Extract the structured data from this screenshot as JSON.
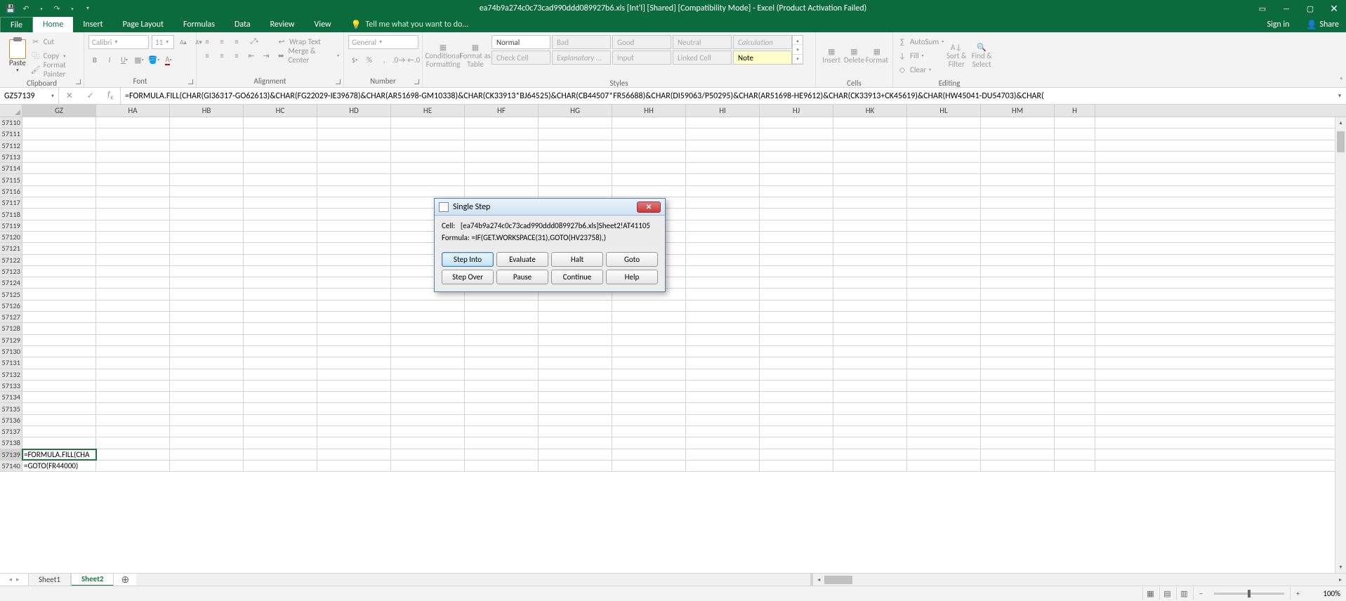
{
  "title": "ea74b9a274c0c73cad990ddd089927b6.xls  [Int'l]  [Shared]  [Compatibility Mode] - Excel (Product Activation Failed)",
  "qat": {
    "save": "💾",
    "undo": "↶",
    "redo": "↷"
  },
  "win": {
    "min": "—",
    "max": "▭",
    "close": "✕",
    "ribmin": "▭"
  },
  "tabs": {
    "file": "File",
    "home": "Home",
    "insert": "Insert",
    "pagelayout": "Page Layout",
    "formulas": "Formulas",
    "data": "Data",
    "review": "Review",
    "view": "View",
    "tellme": "Tell me what you want to do...",
    "signin": "Sign in",
    "share": "Share"
  },
  "ribbon": {
    "clipboard": {
      "label": "Clipboard",
      "paste": "Paste",
      "cut": "Cut",
      "copy": "Copy",
      "fmtpainter": "Format Painter"
    },
    "font": {
      "label": "Font",
      "name": "Calibri",
      "size": "11"
    },
    "alignment": {
      "label": "Alignment",
      "wrap": "Wrap Text",
      "merge": "Merge & Center"
    },
    "number": {
      "label": "Number",
      "combo": "General"
    },
    "styles": {
      "label": "Styles",
      "cond": "Conditional Formatting",
      "fat": "Format as Table",
      "normal": "Normal",
      "bad": "Bad",
      "good": "Good",
      "neutral": "Neutral",
      "calc": "Calculation",
      "check": "Check Cell",
      "explan": "Explanatory ...",
      "input": "Input",
      "linked": "Linked Cell",
      "note": "Note"
    },
    "cells": {
      "label": "Cells",
      "insert": "Insert",
      "delete": "Delete",
      "format": "Format"
    },
    "editing": {
      "label": "Editing",
      "autosum": "AutoSum",
      "fill": "Fill",
      "clear": "Clear",
      "sort": "Sort & Filter",
      "find": "Find & Select"
    }
  },
  "namebox": "GZ57139",
  "fx": "=FORMULA.FILL(CHAR(GI36317-GO62613)&CHAR(FG22029-IE39678)&CHAR(AR51698-GM10338)&CHAR(CK33913*BJ64525)&CHAR(CB44507*FR56688)&CHAR(DI59063/P50295)&CHAR(AR51698-HE9612)&CHAR(CK33913+CK45619)&CHAR(HW45041-DU54703)&CHAR(",
  "columns": [
    "GZ",
    "HA",
    "HB",
    "HC",
    "HD",
    "HE",
    "HF",
    "HG",
    "HH",
    "HI",
    "HJ",
    "HK",
    "HL",
    "HM",
    "H"
  ],
  "rowStart": 57110,
  "rowCount": 31,
  "selRow": 57139,
  "cells": {
    "57139": "=FORMULA.FILL(CHA",
    "57140": "=GOTO(FR44000)"
  },
  "sheets": {
    "s1": "Sheet1",
    "s2": "Sheet2"
  },
  "dialog": {
    "title": "Single Step",
    "cellLabel": "Cell:",
    "cell": "[ea74b9a274c0c73cad990ddd089927b6.xls]Sheet2!AT41105",
    "formulaLabel": "Formula:",
    "formula": "=IF(GET.WORKSPACE(31),GOTO(HV23758),)",
    "btns": {
      "stepinto": "Step Into",
      "evaluate": "Evaluate",
      "halt": "Halt",
      "goto": "Goto",
      "stepover": "Step Over",
      "pause": "Pause",
      "cont": "Continue",
      "help": "Help"
    }
  },
  "zoom": "100%"
}
